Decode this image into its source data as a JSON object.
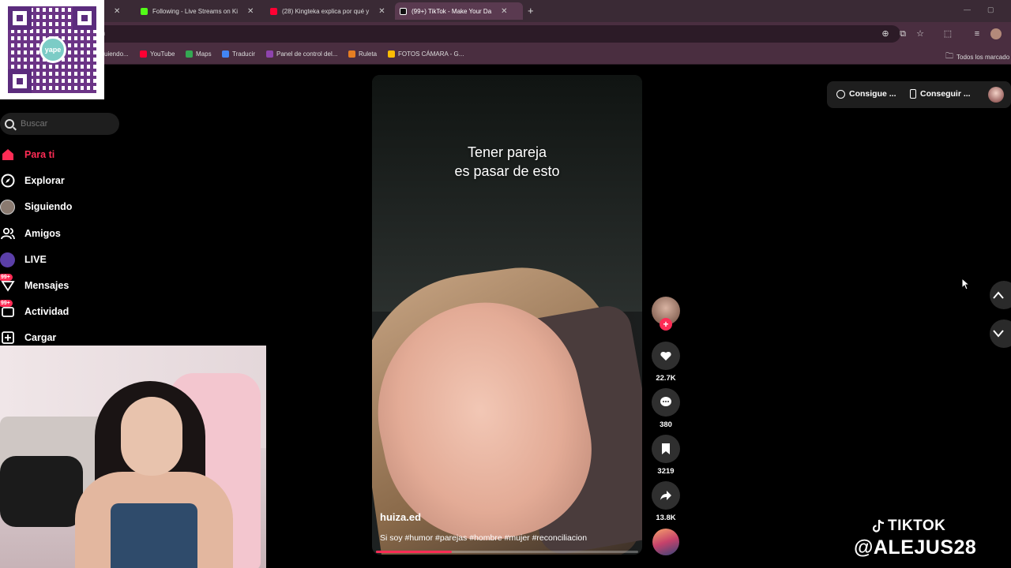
{
  "browser": {
    "tabs": [
      {
        "label": "",
        "active": false
      },
      {
        "label": "Following - Live Streams on Ki",
        "active": false,
        "favicon_color": "#53fc18"
      },
      {
        "label": "(28) Kingteka explica por qué y",
        "active": false,
        "favicon_color": "#ff0033"
      },
      {
        "label": "(99+) TikTok - Make Your Da",
        "active": true,
        "favicon_color": "#ffffff"
      }
    ],
    "address": "n",
    "bookmarks": [
      {
        "label": "uiendo..."
      },
      {
        "label": "YouTube",
        "color": "#ff0033"
      },
      {
        "label": "Maps",
        "color": "#34a853"
      },
      {
        "label": "Traducir",
        "color": "#4285f4"
      },
      {
        "label": "Panel de control del...",
        "color": "#8e44ad"
      },
      {
        "label": "Ruleta",
        "color": "#e67e22"
      },
      {
        "label": "FOTOS CÁMARA - G...",
        "color": "#fbbc04"
      }
    ],
    "all_bookmarks": "Todos los marcado"
  },
  "qr": {
    "logo_text": "yape"
  },
  "sidebar": {
    "search_placeholder": "Buscar",
    "items": [
      {
        "label": "Para ti",
        "icon": "home-icon",
        "active": true
      },
      {
        "label": "Explorar",
        "icon": "compass-icon"
      },
      {
        "label": "Siguiendo",
        "icon": "following-avatar-icon"
      },
      {
        "label": "Amigos",
        "icon": "friends-icon"
      },
      {
        "label": "LIVE",
        "icon": "live-icon"
      },
      {
        "label": "Mensajes",
        "icon": "messages-icon",
        "badge": "99+"
      },
      {
        "label": "Actividad",
        "icon": "activity-icon",
        "badge": "99+"
      },
      {
        "label": "Cargar",
        "icon": "upload-icon"
      }
    ]
  },
  "video": {
    "caption_line1": "Tener pareja",
    "caption_line2": "es pasar de esto",
    "author": "huiza.ed",
    "description": "Si soy #humor #parejas #hombre #mujer #reconciliacion",
    "progress": 0.29
  },
  "actions": {
    "likes": "22.7K",
    "comments": "380",
    "saves": "3219",
    "shares": "13.8K"
  },
  "topbar": {
    "btn1": "Consigue ...",
    "btn2": "Conseguir ..."
  },
  "overlay": {
    "brand": "TIKTOK",
    "handle": "@ALEJUS28"
  },
  "colors": {
    "accent": "#fe2c55"
  }
}
